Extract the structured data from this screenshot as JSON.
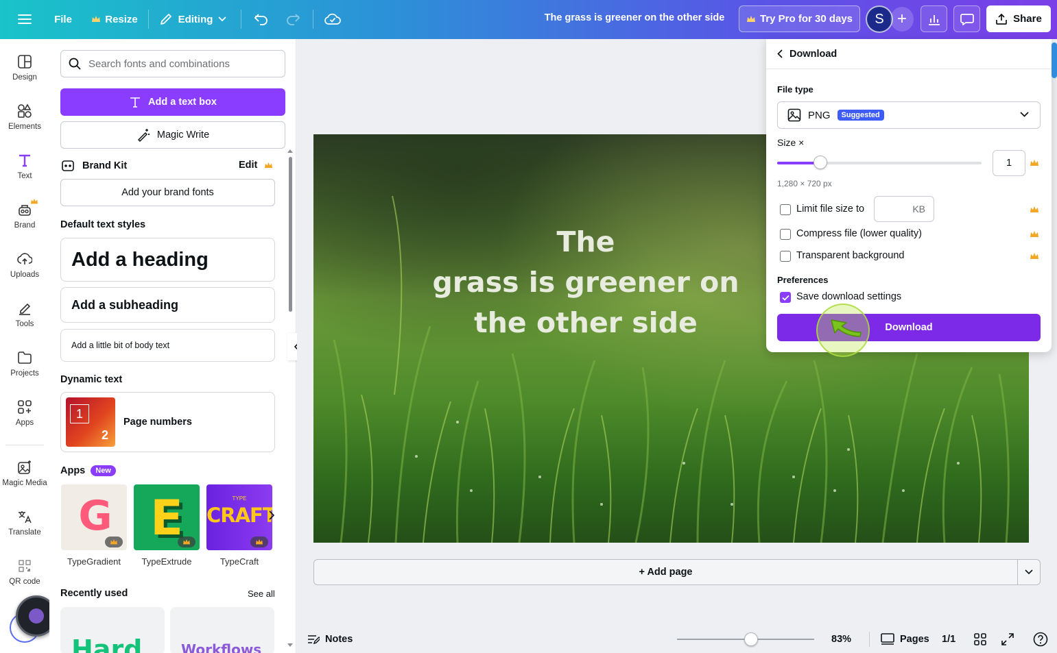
{
  "header": {
    "file_label": "File",
    "resize_label": "Resize",
    "editing_label": "Editing",
    "doc_title": "The grass is greener on the other side",
    "try_pro_label": "Try Pro for 30 days",
    "avatar_initial": "S",
    "share_label": "Share"
  },
  "rail": {
    "items": [
      {
        "label": "Design",
        "icon": "design-icon"
      },
      {
        "label": "Elements",
        "icon": "elements-icon"
      },
      {
        "label": "Text",
        "icon": "text-icon"
      },
      {
        "label": "Brand",
        "icon": "brand-icon"
      },
      {
        "label": "Uploads",
        "icon": "uploads-icon"
      },
      {
        "label": "Tools",
        "icon": "tools-icon"
      },
      {
        "label": "Projects",
        "icon": "projects-icon"
      },
      {
        "label": "Apps",
        "icon": "apps-icon"
      },
      {
        "label": "Magic Media",
        "icon": "magic-media-icon"
      },
      {
        "label": "Translate",
        "icon": "translate-icon"
      },
      {
        "label": "QR code",
        "icon": "qr-code-icon"
      }
    ]
  },
  "panel": {
    "search_placeholder": "Search fonts and combinations",
    "add_text_box": "Add a text box",
    "magic_write": "Magic Write",
    "brand_kit": "Brand Kit",
    "brand_edit": "Edit",
    "add_brand_fonts": "Add your brand fonts",
    "default_styles": "Default text styles",
    "heading": "Add a heading",
    "subheading": "Add a subheading",
    "body": "Add a little bit of body text",
    "dynamic_text": "Dynamic text",
    "page_numbers": "Page numbers",
    "page_num_a": "1",
    "page_num_b": "2",
    "apps_title": "Apps",
    "apps_badge": "New",
    "apps": [
      {
        "name": "TypeGradient"
      },
      {
        "name": "TypeExtrude"
      },
      {
        "name": "TypeCraft"
      }
    ],
    "typecraft_logo": "CRAFT",
    "typecraft_small": "TYPE",
    "typeextrude_logo": "E",
    "typegradient_logo": "G",
    "recently_used": "Recently used",
    "see_all": "See all",
    "recent_1": "Hard",
    "recent_2": "Workflows"
  },
  "canvas": {
    "text_line1": "The",
    "text_line2": "grass is greener on",
    "text_line3": "the other side",
    "add_page": "+ Add page"
  },
  "bottom": {
    "notes": "Notes",
    "zoom": "83%",
    "zoom_fraction": 0.54,
    "pages": "Pages",
    "page_count": "1/1"
  },
  "download": {
    "title": "Download",
    "file_type_label": "File type",
    "file_type": "PNG",
    "suggested": "Suggested",
    "size_label": "Size ×",
    "size_value": "1",
    "size_fraction": 0.21,
    "dimensions": "1,280 × 720 px",
    "limit_label": "Limit file size to",
    "kb_placeholder": "KB",
    "compress_label": "Compress file (lower quality)",
    "transparent_label": "Transparent background",
    "preferences_label": "Preferences",
    "save_settings_label": "Save download settings",
    "download_button": "Download"
  },
  "colors": {
    "accent": "#8b3dff",
    "download_button": "#7d2ae8",
    "crown": "#f5a623"
  }
}
